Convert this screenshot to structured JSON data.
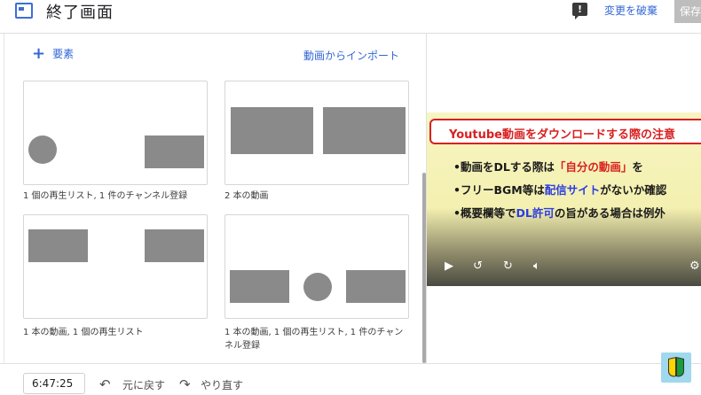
{
  "header": {
    "title": "終了画面",
    "feedback_icon": "feedback-icon",
    "discard_label": "変更を破棄",
    "save_label": "保存"
  },
  "toolbar": {
    "add_element_label": "要素",
    "import_label": "動画からインポート"
  },
  "templates": [
    {
      "caption": "1 個の再生リスト, 1 件のチャンネル登録"
    },
    {
      "caption": "2 本の動画"
    },
    {
      "caption": "1 本の動画, 1 個の再生リスト"
    },
    {
      "caption": "1 本の動画, 1 個の再生リスト, 1 件のチャンネル登録"
    }
  ],
  "video": {
    "title": "Youtube動画をダウンロードする際の注意",
    "bullets": [
      {
        "pre": "•動画をDLする際は",
        "hl": "「自分の動画」",
        "post": "を"
      },
      {
        "pre": "•フリーBGM等は",
        "hl": "配信サイト",
        "post": "がないか確認"
      },
      {
        "pre": "•概要欄等で",
        "hl": "DL許可",
        "post": "の旨がある場合は例外"
      }
    ],
    "controls": [
      "play-icon",
      "rewind-10-icon",
      "forward-10-icon",
      "volume-icon",
      "settings-icon"
    ]
  },
  "footer": {
    "timecode": "6:47:25",
    "undo_label": "元に戻す",
    "redo_label": "やり直す"
  },
  "colors": {
    "accent": "#3367d6",
    "placeholder_shape": "#8a8a8a",
    "video_highlight_red": "#d92020",
    "video_highlight_blue": "#2b3de0"
  }
}
